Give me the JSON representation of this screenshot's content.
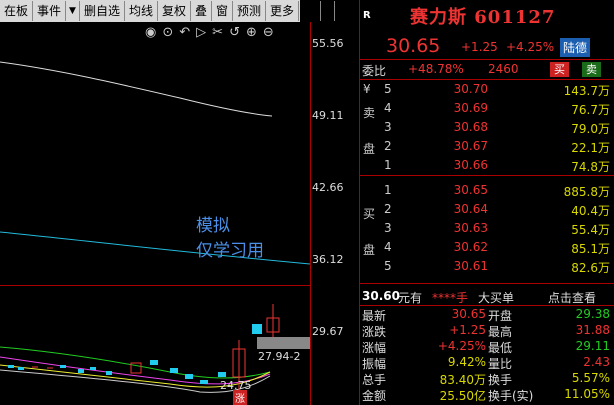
{
  "toolbar": {
    "items": [
      "在板",
      "事件",
      "▼",
      "删自选",
      "均线",
      "复权",
      "叠",
      "窗",
      "预测",
      "更多",
      "▶|",
      "▼"
    ]
  },
  "icons": [
    "eye-icon",
    "search-icon",
    "undo-icon",
    "redo-icon",
    "scissors-icon",
    "reset-icon",
    "zoom-in-icon",
    "zoom-out-icon"
  ],
  "price_axis": [
    "55.56",
    "49.11",
    "42.66",
    "36.12",
    "29.67"
  ],
  "chart_annotations": {
    "high_label": "27.94-2",
    "low_label": "24.75",
    "limit_badge": "涨"
  },
  "watermark": {
    "line1": "模拟",
    "line2": "仅学习用"
  },
  "quote": {
    "badge": "R",
    "name_code": "赛力斯 601127",
    "price": "30.65",
    "change": "+1.25",
    "change_pct": "+4.25%",
    "tag": "陆德",
    "wei_bi_label": "委比",
    "wei_bi_value": "+48.78%",
    "wei_cha": "2460",
    "buy_btn": "买",
    "sell_btn": "卖"
  },
  "asks": {
    "side_label": [
      "¥",
      "卖",
      "盘"
    ],
    "rows": [
      {
        "level": "5",
        "price": "30.70",
        "vol": "143.7万"
      },
      {
        "level": "4",
        "price": "30.69",
        "vol": "76.7万"
      },
      {
        "level": "3",
        "price": "30.68",
        "vol": "79.0万"
      },
      {
        "level": "2",
        "price": "30.67",
        "vol": "22.1万"
      },
      {
        "level": "1",
        "price": "30.66",
        "vol": "74.8万"
      }
    ]
  },
  "bids": {
    "side_label": [
      "买",
      "盘"
    ],
    "rows": [
      {
        "level": "1",
        "price": "30.65",
        "vol": "885.8万"
      },
      {
        "level": "2",
        "price": "30.64",
        "vol": "40.4万"
      },
      {
        "level": "3",
        "price": "30.63",
        "vol": "55.4万"
      },
      {
        "level": "4",
        "price": "30.62",
        "vol": "85.1万"
      },
      {
        "level": "5",
        "price": "30.61",
        "vol": "82.6万"
      }
    ]
  },
  "trade_line": {
    "price": "30.60",
    "unit": "元有",
    "stars": "****手",
    "big": "大买单",
    "link": "点击查看"
  },
  "stats": [
    {
      "l1": "最新",
      "v1": "30.65",
      "l2": "开盘",
      "v2": "29.38",
      "c1": "red",
      "c2": "grn"
    },
    {
      "l1": "涨跌",
      "v1": "+1.25",
      "l2": "最高",
      "v2": "31.88",
      "c1": "red",
      "c2": "red"
    },
    {
      "l1": "涨幅",
      "v1": "+4.25%",
      "l2": "最低",
      "v2": "29.11",
      "c1": "red",
      "c2": "grn"
    },
    {
      "l1": "振幅",
      "v1": "9.42%",
      "l2": "量比",
      "v2": "2.43",
      "c1": "yel",
      "c2": "red"
    },
    {
      "l1": "总手",
      "v1": "83.40万",
      "l2": "换手",
      "v2": "5.57%",
      "c1": "yel",
      "c2": "yel"
    },
    {
      "l1": "金额",
      "v1": "25.50亿",
      "l2": "换手(实)",
      "v2": "11.05%",
      "c1": "yel",
      "c2": "yel"
    }
  ]
}
